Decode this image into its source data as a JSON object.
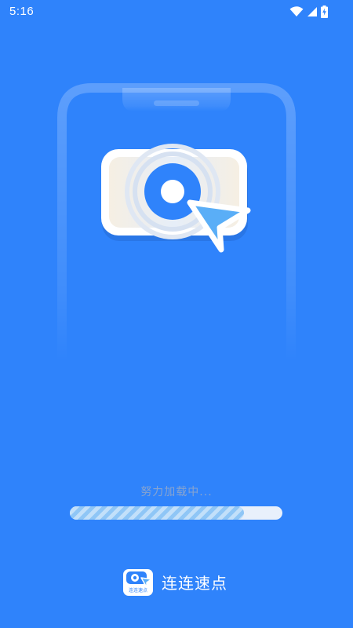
{
  "status_bar": {
    "time": "5:16",
    "icons": [
      "wifi-icon",
      "cellular-signal-icon",
      "battery-charging-icon"
    ]
  },
  "loading": {
    "text": "努力加载中...",
    "progress": 0.82
  },
  "brand": {
    "name": "连连速点",
    "logo_caption": "连连速点"
  },
  "colors": {
    "background": "#2f83fb",
    "progress_fill": "#8fc6f6",
    "progress_track": "#e8f0fb",
    "cursor_blue": "#5aaef7"
  }
}
